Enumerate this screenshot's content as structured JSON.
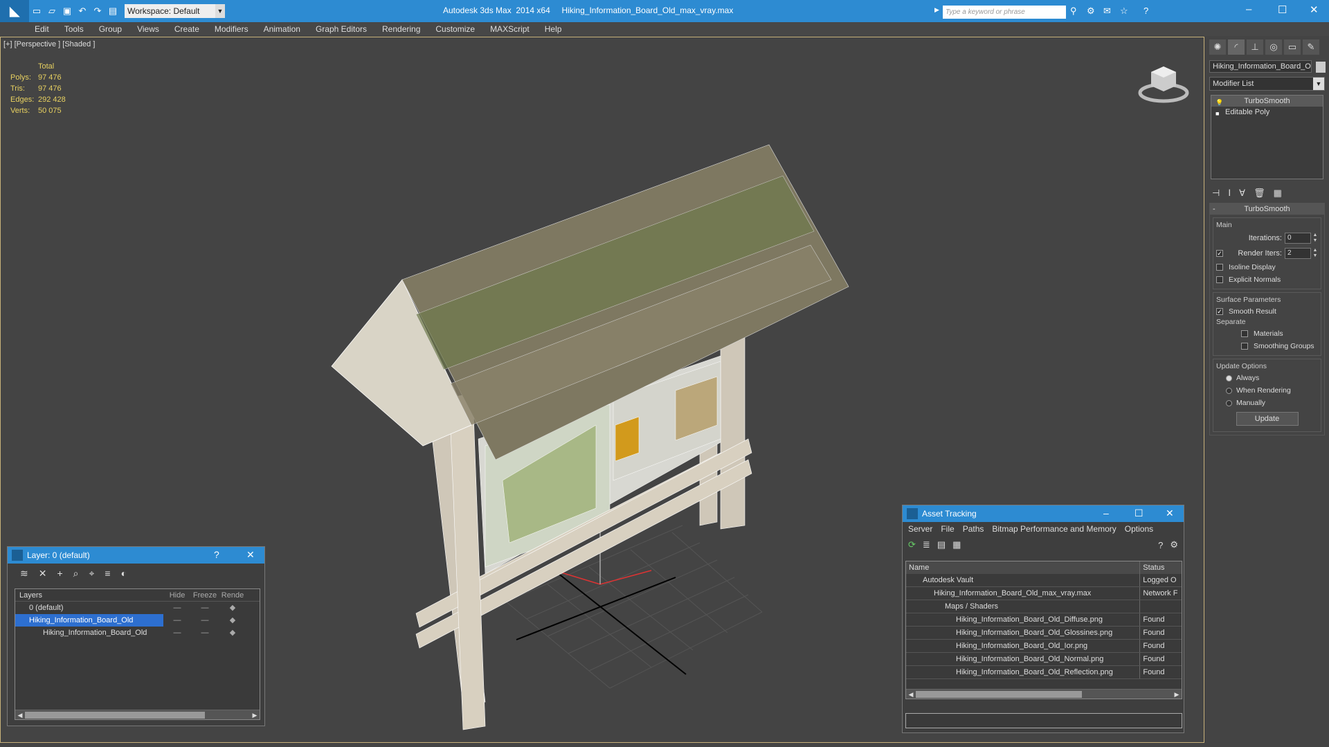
{
  "titlebar": {
    "app_icon": "3ds-max-logo-icon",
    "workspace": "Workspace: Default",
    "app_title": "Autodesk 3ds Max  2014 x64",
    "file_title": "Hiking_Information_Board_Old_max_vray.max",
    "search_placeholder": "Type a keyword or phrase"
  },
  "menubar": [
    "Edit",
    "Tools",
    "Group",
    "Views",
    "Create",
    "Modifiers",
    "Animation",
    "Graph Editors",
    "Rendering",
    "Customize",
    "MAXScript",
    "Help"
  ],
  "viewport": {
    "label": "[+] [Perspective ] [Shaded ]",
    "stats": {
      "header": "Total",
      "rows": [
        {
          "label": "Polys:",
          "value": "97 476"
        },
        {
          "label": "Tris:",
          "value": "97 476"
        },
        {
          "label": "Edges:",
          "value": "292 428"
        },
        {
          "label": "Verts:",
          "value": "50 075"
        }
      ]
    }
  },
  "command_panel": {
    "object_name": "Hiking_Information_Board_Ol",
    "modifier_list": "Modifier List",
    "stack": [
      "TurboSmooth",
      "Editable Poly"
    ],
    "turbosmooth": {
      "title": "TurboSmooth",
      "main_label": "Main",
      "iterations_label": "Iterations:",
      "iterations_value": "0",
      "render_iters_label": "Render Iters:",
      "render_iters_value": "2",
      "isoline_display": "Isoline Display",
      "explicit_normals": "Explicit Normals",
      "surface_params_label": "Surface Parameters",
      "smooth_result": "Smooth Result",
      "separate_label": "Separate",
      "materials": "Materials",
      "smoothing_groups": "Smoothing Groups",
      "update_options_label": "Update Options",
      "always": "Always",
      "when_rendering": "When Rendering",
      "manually": "Manually",
      "update_button": "Update"
    }
  },
  "layer_window": {
    "title": "Layer: 0 (default)",
    "help": "?",
    "headers": {
      "layers": "Layers",
      "hide": "Hide",
      "freeze": "Freeze",
      "render": "Rende"
    },
    "rows": [
      {
        "name": "0 (default)",
        "hide": "—",
        "freeze": "—"
      },
      {
        "name": "Hiking_Information_Board_Old",
        "hide": "—",
        "freeze": "—"
      },
      {
        "name": "Hiking_Information_Board_Old",
        "hide": "—",
        "freeze": "—"
      }
    ]
  },
  "asset_window": {
    "title": "Asset Tracking",
    "menu": [
      "Server",
      "File",
      "Paths",
      "Bitmap Performance and Memory",
      "Options"
    ],
    "headers": {
      "name": "Name",
      "status": "Status"
    },
    "rows": [
      {
        "name": "Autodesk Vault",
        "status": "Logged O"
      },
      {
        "name": "Hiking_Information_Board_Old_max_vray.max",
        "status": "Network F"
      },
      {
        "name": "Maps / Shaders",
        "status": ""
      },
      {
        "name": "Hiking_Information_Board_Old_Diffuse.png",
        "status": "Found"
      },
      {
        "name": "Hiking_Information_Board_Old_Glossines.png",
        "status": "Found"
      },
      {
        "name": "Hiking_Information_Board_Old_Ior.png",
        "status": "Found"
      },
      {
        "name": "Hiking_Information_Board_Old_Normal.png",
        "status": "Found"
      },
      {
        "name": "Hiking_Information_Board_Old_Reflection.png",
        "status": "Found"
      }
    ]
  }
}
